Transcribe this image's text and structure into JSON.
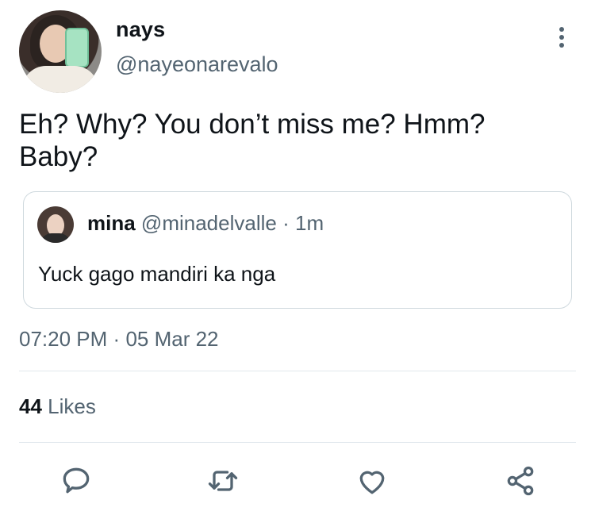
{
  "author": {
    "name": "nays",
    "handle": "@nayeonarevalo"
  },
  "tweet": {
    "text_line1": "Eh? Why? You don’t miss me? Hmm?",
    "text_line2": "Baby?"
  },
  "quoted_tweet": {
    "name": "mina",
    "handle": "@minadelvalle",
    "separator": "·",
    "time_ago": "1m",
    "text": "Yuck gago mandiri ka nga"
  },
  "meta": {
    "time": "07:20 PM",
    "separator": "·",
    "date": "05 Mar 22"
  },
  "stats": {
    "likes_count": "44",
    "likes_label": "Likes"
  },
  "actions": [
    {
      "name": "reply",
      "icon": "speech-bubble-icon"
    },
    {
      "name": "retweet",
      "icon": "retweet-icon"
    },
    {
      "name": "like",
      "icon": "heart-icon"
    },
    {
      "name": "share",
      "icon": "share-nodes-icon"
    }
  ],
  "colors": {
    "text": "#0f1419",
    "secondary": "#536471",
    "border": "#cfd9de",
    "divider": "#e1e8ed"
  }
}
